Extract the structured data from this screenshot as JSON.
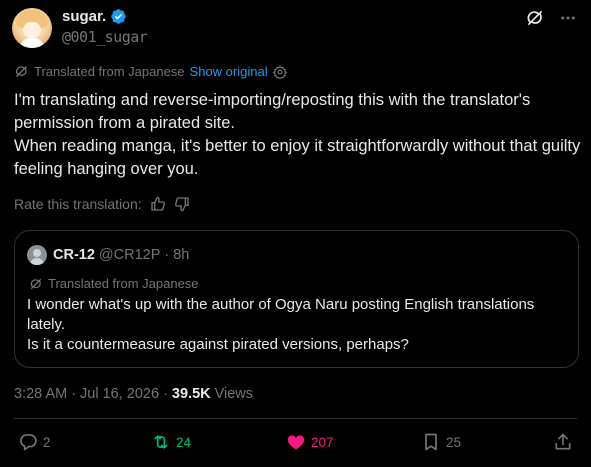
{
  "author": {
    "display_name": "sugar.",
    "handle": "@001_sugar"
  },
  "translation": {
    "label": "Translated from Japanese",
    "show_original": "Show original"
  },
  "tweet_text": "I'm translating and reverse-importing/reposting this with the translator's permission from a pirated site.\nWhen reading manga, it's better to enjoy it straightforwardly without that guilty feeling hanging over you.",
  "rate_label": "Rate this translation:",
  "quote": {
    "name": "CR-12",
    "handle": "@CR12P",
    "dot": "·",
    "time": "8h",
    "translated_label": "Translated from Japanese",
    "text": "I wonder what's up with the author of Ogya Naru posting English translations lately.\nIs it a countermeasure against pirated versions, perhaps?"
  },
  "meta": {
    "time": "3:28 AM",
    "sep1": "·",
    "date": "Jul 16, 2026",
    "sep2": "·",
    "views_count": "39.5K",
    "views_label": "Views"
  },
  "actions": {
    "replies": "2",
    "retweets": "24",
    "likes": "207",
    "bookmarks": "25"
  },
  "colors": {
    "background": "#000000",
    "text": "#e7e9ea",
    "muted": "#71767b",
    "link": "#1d9bf0",
    "retweet": "#00ba7c",
    "like": "#f91880",
    "border": "#2f3336"
  }
}
